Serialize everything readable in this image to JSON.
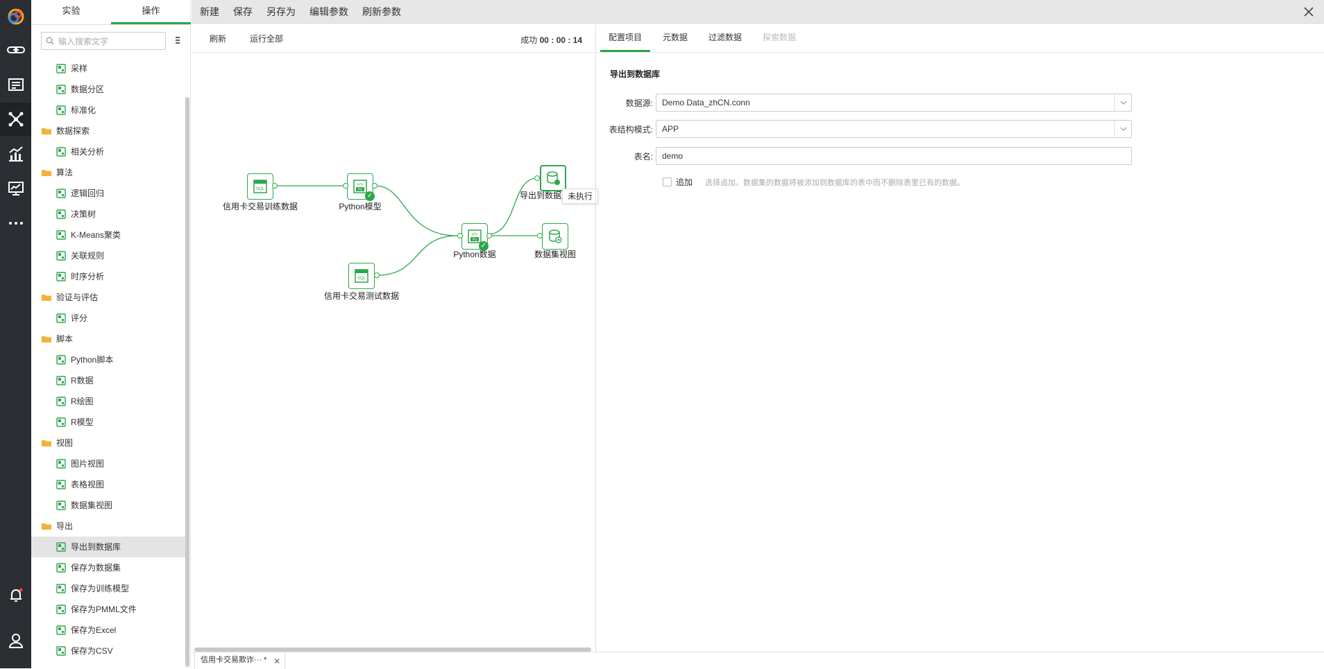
{
  "colors": {
    "accent": "#2da64b",
    "rail": "#2b2f33"
  },
  "rail": {
    "icons": [
      "link-icon",
      "report-icon",
      "network-icon",
      "analysis-chart-icon",
      "monitor-icon",
      "more-icon",
      "notification-icon",
      "user-icon"
    ]
  },
  "panel": {
    "tabs": [
      "实验",
      "操作"
    ],
    "active_tab": "操作",
    "search_placeholder": "输入搜索文字",
    "tree": [
      {
        "kind": "item",
        "label": "采样",
        "icon": "sampling-icon"
      },
      {
        "kind": "item",
        "label": "数据分区",
        "icon": "partition-icon"
      },
      {
        "kind": "item",
        "label": "标准化",
        "icon": "normalize-icon"
      },
      {
        "kind": "cat",
        "label": "数据探索",
        "icon": "folder-icon"
      },
      {
        "kind": "item",
        "label": "相关分析",
        "icon": "correlation-icon"
      },
      {
        "kind": "cat",
        "label": "算法",
        "icon": "folder-icon"
      },
      {
        "kind": "item",
        "label": "逻辑回归",
        "icon": "logistic-regression-icon"
      },
      {
        "kind": "item",
        "label": "决策树",
        "icon": "decision-tree-icon"
      },
      {
        "kind": "item",
        "label": "K-Means聚类",
        "icon": "kmeans-icon"
      },
      {
        "kind": "item",
        "label": "关联规则",
        "icon": "association-icon"
      },
      {
        "kind": "item",
        "label": "时序分析",
        "icon": "timeseries-icon"
      },
      {
        "kind": "cat",
        "label": "验证与评估",
        "icon": "folder-icon"
      },
      {
        "kind": "item",
        "label": "评分",
        "icon": "score-icon"
      },
      {
        "kind": "cat",
        "label": "脚本",
        "icon": "folder-icon"
      },
      {
        "kind": "item",
        "label": "Python脚本",
        "icon": "python-script-icon"
      },
      {
        "kind": "item",
        "label": "R数据",
        "icon": "r-data-icon"
      },
      {
        "kind": "item",
        "label": "R绘图",
        "icon": "r-plot-icon"
      },
      {
        "kind": "item",
        "label": "R模型",
        "icon": "r-model-icon"
      },
      {
        "kind": "cat",
        "label": "视图",
        "icon": "folder-icon"
      },
      {
        "kind": "item",
        "label": "图片视图",
        "icon": "image-view-icon"
      },
      {
        "kind": "item",
        "label": "表格视图",
        "icon": "table-view-icon"
      },
      {
        "kind": "item",
        "label": "数据集视图",
        "icon": "dataset-view-icon"
      },
      {
        "kind": "cat",
        "label": "导出",
        "icon": "folder-icon"
      },
      {
        "kind": "item",
        "label": "导出到数据库",
        "icon": "export-db-icon",
        "selected": true
      },
      {
        "kind": "item",
        "label": "保存为数据集",
        "icon": "save-dataset-icon"
      },
      {
        "kind": "item",
        "label": "保存为训练模型",
        "icon": "save-model-icon"
      },
      {
        "kind": "item",
        "label": "保存为PMML文件",
        "icon": "save-pmml-icon"
      },
      {
        "kind": "item",
        "label": "保存为Excel",
        "icon": "save-excel-icon"
      },
      {
        "kind": "item",
        "label": "保存为CSV",
        "icon": "save-csv-icon"
      }
    ]
  },
  "topbar": {
    "menu": [
      "新建",
      "保存",
      "另存为",
      "编辑参数",
      "刷新参数"
    ]
  },
  "canvas": {
    "toolbar": [
      "刷新",
      "运行全部"
    ],
    "status_label": "成功",
    "status_time": "00 : 00 : 14",
    "tooltip": "未执行",
    "nodes": {
      "train": "信用卡交易训练数据",
      "pymodel": "Python模型",
      "test": "信用卡交易测试数据",
      "pydata": "Python数据",
      "export": "导出到数据库",
      "dsview": "数据集视图"
    }
  },
  "props": {
    "tabs": [
      "配置项目",
      "元数据",
      "过滤数据",
      "探索数据"
    ],
    "section_title": "导出到数据库",
    "fields": {
      "datasource_label": "数据源:",
      "datasource_value": "Demo Data_zhCN.conn",
      "schema_label": "表结构模式:",
      "schema_value": "APP",
      "table_label": "表名:",
      "table_value": "demo"
    },
    "append_label": "追加",
    "append_hint": "选择追加，数据集的数据将被添加到数据库的表中而不删除表里已有的数据。"
  },
  "bottom": {
    "doc_tab": "信用卡交易欺诈··· *"
  }
}
